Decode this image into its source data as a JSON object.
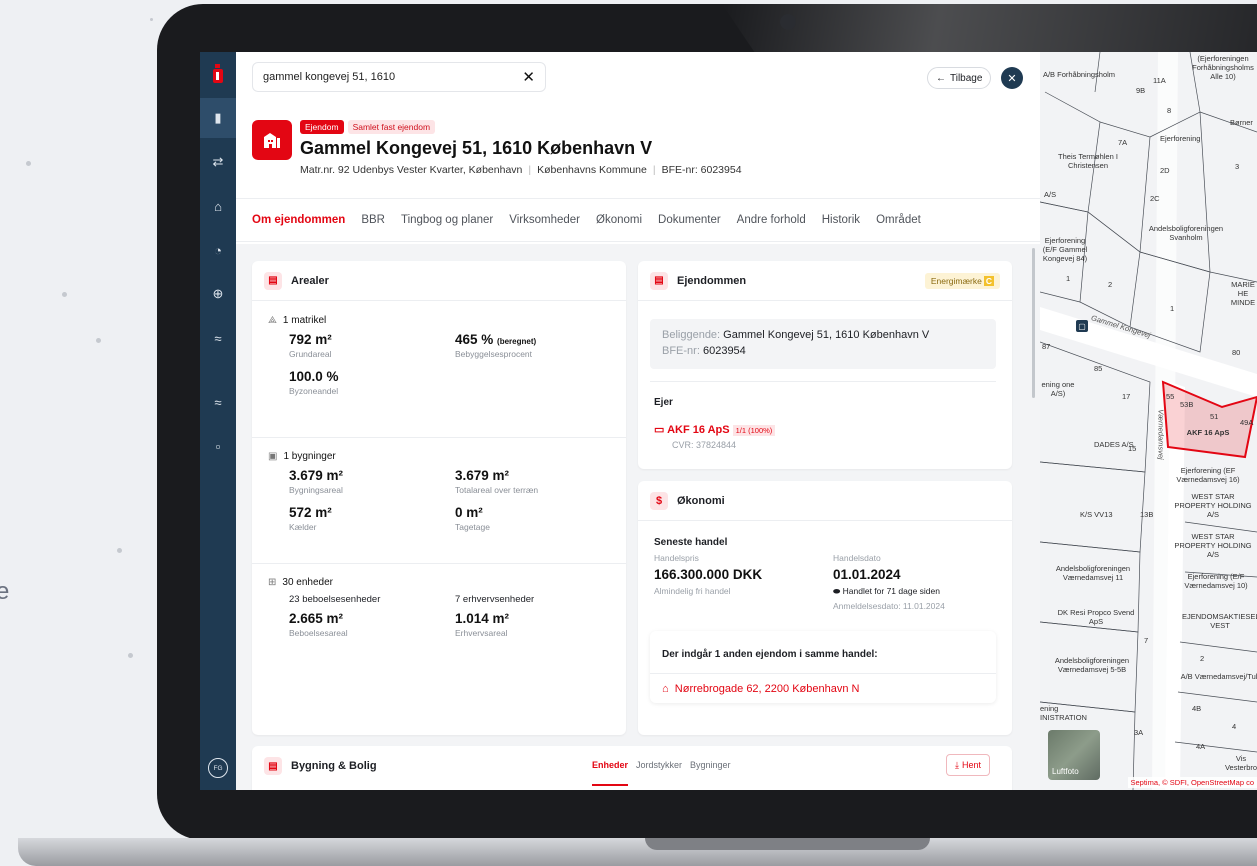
{
  "backdrop": {
    "edge_letter": "e"
  },
  "search": {
    "value": "gammel kongevej 51, 1610"
  },
  "header": {
    "back_label": "Tilbage",
    "badge_type": "Ejendom",
    "badge_kind": "Samlet fast ejendom",
    "title": "Gammel Kongevej 51, 1610 København V",
    "matrikel": "Matr.nr. 92 Udenbys Vester Kvarter, København",
    "kommune": "Københavns Kommune",
    "bfe": "BFE-nr: 6023954"
  },
  "tabs": [
    "Om ejendommen",
    "BBR",
    "Tingbog og planer",
    "Virksomheder",
    "Økonomi",
    "Dokumenter",
    "Andre forhold",
    "Historik",
    "Området"
  ],
  "arealer": {
    "title": "Arealer",
    "matrikel_head": "1 matrikel",
    "grundareal_value": "792 m²",
    "grundareal_label": "Grundareal",
    "bebyggelse_value": "465 %",
    "bebyggelse_note": "(beregnet)",
    "bebyggelse_label": "Bebyggelsesprocent",
    "byzone_value": "100.0 %",
    "byzone_label": "Byzoneandel",
    "bygninger_head": "1 bygninger",
    "bygningsareal_value": "3.679 m²",
    "bygningsareal_label": "Bygningsareal",
    "totalareal_value": "3.679 m²",
    "totalareal_label": "Totalareal over terræn",
    "kaelder_value": "572 m²",
    "kaelder_label": "Kælder",
    "tagetage_value": "0 m²",
    "tagetage_label": "Tagetage",
    "enheder_head": "30 enheder",
    "beboelse_count": "23 beboelsesenheder",
    "erhverv_count": "7 erhvervsenheder",
    "beboelse_value": "2.665 m²",
    "beboelse_label": "Beboelsesareal",
    "erhverv_value": "1.014 m²",
    "erhverv_label": "Erhvervsareal"
  },
  "ejendommen": {
    "title": "Ejendommen",
    "energy_label": "Energimærke",
    "energy_grade": "C",
    "beliggende_key": "Beliggende:",
    "beliggende_value": "Gammel Kongevej 51, 1610 København V",
    "bfe_key": "BFE-nr:",
    "bfe_value": "6023954",
    "owner_head": "Ejer",
    "owner_name": "AKF 16 ApS",
    "owner_share": "1/1 (100%)",
    "cvr": "CVR: 37824844"
  },
  "oekonomi": {
    "title": "Økonomi",
    "section": "Seneste handel",
    "price_label": "Handelspris",
    "price_value": "166.300.000 DKK",
    "price_note": "Almindelig fri handel",
    "date_label": "Handelsdato",
    "date_value": "01.01.2024",
    "date_note": "Handlet for 71 dage siden",
    "registered": "Anmeldelsesdato: 11.01.2024",
    "other_title": "Der indgår 1 anden ejendom i samme handel:",
    "other_address": "Nørrebrogade 62, 2200 København N"
  },
  "bygning": {
    "title": "Bygning & Bolig",
    "tabs": [
      "Enheder",
      "Jordstykker",
      "Bygninger"
    ],
    "download_label": "Hent"
  },
  "sidebar": {
    "avatar_initials": "FG"
  },
  "map": {
    "labels": [
      "A/B Forhåbningsholm",
      "(Ejerforeningen Forhåbningsholms Alle 10)",
      "Børner",
      "Ejerforening",
      "Theis Termøhlen I Christensen",
      "A/S",
      "Andelsboligforeningen Svanholm",
      "Ejerforening (E/F Gammel Kongevej 84)",
      "MARIE HE MINDE",
      "Gammel Kongevej",
      "ening one A/S)",
      "Værnedamsvej",
      "AKF 16 ApS",
      "DADES A/S",
      "Ejerforening (EF Værnedamsvej 16)",
      "WEST STAR PROPERTY HOLDING A/S",
      "K/S VV13",
      "WEST STAR PROPERTY HOLDING A/S",
      "Andelsboligforeningen Værnedamsvej 11",
      "Ejerforening (E/F Værnedamsvej 10)",
      "DK Resi Propco Svend ApS",
      "EJENDOMSAKTIESELSK VEST",
      "Andelsboligforeningen Værnedamsvej 5-5B",
      "A/B Værnedamsvej/Tul",
      "ening INISTRATION",
      "Vis Vesterbro"
    ],
    "numbers": [
      "11A",
      "9B",
      "8",
      "7A",
      "2D",
      "3",
      "2C",
      "1",
      "2",
      "1",
      "80",
      "87",
      "85",
      "17",
      "15",
      "55",
      "53B",
      "51",
      "49A",
      "13B",
      "7",
      "2",
      "4B",
      "3A",
      "4A",
      "4"
    ],
    "satellite_label": "Luftfoto",
    "attribution": "Septima, © SDFI, OpenStreetMap co"
  }
}
